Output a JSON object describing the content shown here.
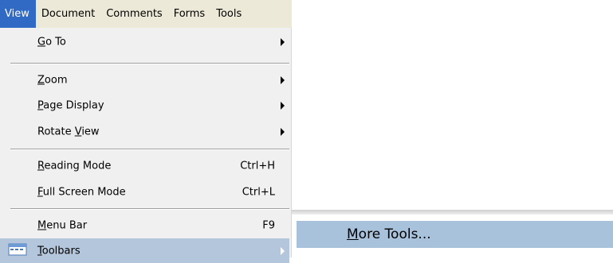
{
  "menubar": {
    "items": [
      {
        "label": "View",
        "active": true
      },
      {
        "label": "Document"
      },
      {
        "label": "Comments"
      },
      {
        "label": "Forms"
      },
      {
        "label": "Tools"
      }
    ]
  },
  "view_menu": {
    "goto": {
      "pre": "",
      "mnemonic": "G",
      "post": "o To",
      "has_submenu": true
    },
    "zoom": {
      "pre": "",
      "mnemonic": "Z",
      "post": "oom",
      "has_submenu": true
    },
    "page_display": {
      "pre": "",
      "mnemonic": "P",
      "post": "age Display",
      "has_submenu": true
    },
    "rotate_view": {
      "pre": "Rotate ",
      "mnemonic": "V",
      "post": "iew",
      "has_submenu": true
    },
    "reading_mode": {
      "pre": "",
      "mnemonic": "R",
      "post": "eading Mode",
      "shortcut": "Ctrl+H"
    },
    "full_screen_mode": {
      "pre": "",
      "mnemonic": "F",
      "post": "ull Screen Mode",
      "shortcut": "Ctrl+L"
    },
    "menu_bar": {
      "pre": "",
      "mnemonic": "M",
      "post": "enu Bar",
      "shortcut": "F9"
    },
    "toolbars": {
      "pre": "",
      "mnemonic": "T",
      "post": "oolbars",
      "has_submenu": true,
      "highlighted": true,
      "icon": "toolbar-icon"
    }
  },
  "toolbars_submenu": {
    "more_tools": {
      "pre": "",
      "mnemonic": "M",
      "post": "ore Tools..."
    }
  },
  "colors": {
    "menubar_bg": "#ece9d8",
    "active_menu_bg": "#316ac5",
    "dropdown_bg": "#f0f0f0",
    "highlight_bg": "#b4c6dc",
    "submenu_highlight_bg": "#a9c2dc"
  }
}
